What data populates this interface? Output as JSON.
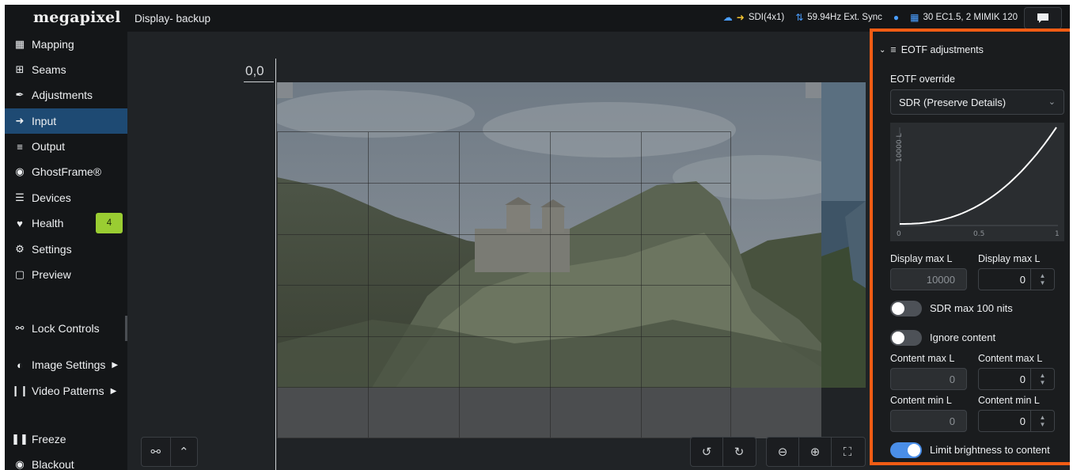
{
  "app": {
    "brand": "megapixel",
    "window_title": "Display- backup"
  },
  "status": {
    "input": "SDI(4x1)",
    "sync": "59.94Hz Ext. Sync",
    "devices": "30 EC1.5, 2 MIMIK 120"
  },
  "sidebar": {
    "items": [
      {
        "label": "Mapping",
        "icon": "grid-icon"
      },
      {
        "label": "Seams",
        "icon": "plus-square-icon"
      },
      {
        "label": "Adjustments",
        "icon": "brush-icon"
      },
      {
        "label": "Input",
        "icon": "input-arrow-icon"
      },
      {
        "label": "Output",
        "icon": "sliders-icon"
      },
      {
        "label": "GhostFrame®",
        "icon": "ghostframe-icon"
      },
      {
        "label": "Devices",
        "icon": "list-icon"
      },
      {
        "label": "Health",
        "icon": "heart-pulse-icon",
        "badge": "4"
      },
      {
        "label": "Settings",
        "icon": "gears-icon"
      },
      {
        "label": "Preview",
        "icon": "monitor-icon"
      },
      {
        "label": "Lock Controls",
        "icon": "unlock-icon"
      },
      {
        "label": "Image Settings",
        "icon": "contrast-icon"
      },
      {
        "label": "Video Patterns",
        "icon": "bars-icon"
      },
      {
        "label": "Freeze",
        "icon": "pause-icon"
      },
      {
        "label": "Blackout",
        "icon": "bulb-icon"
      }
    ],
    "active": "Input"
  },
  "canvas": {
    "origin_label": "0,0"
  },
  "panel": {
    "header": "EOTF adjustments",
    "eotf_override_label": "EOTF override",
    "eotf_override_value": "SDR (Preserve Details)",
    "chart_axis": {
      "y_label": "10000 L",
      "x_ticks": [
        "0",
        "0.5",
        "1"
      ]
    },
    "display_max_label_a": "Display max L",
    "display_max_value_a": "10000",
    "display_max_label_b": "Display max L",
    "display_max_value_b": "0",
    "sdr_toggle_label": "SDR max 100 nits",
    "sdr_toggle_on": false,
    "ignore_toggle_label": "Ignore content",
    "ignore_toggle_on": false,
    "content_max_label_a": "Content max L",
    "content_max_value_a": "0",
    "content_max_label_b": "Content max L",
    "content_max_value_b": "0",
    "content_min_label_a": "Content min L",
    "content_min_value_a": "0",
    "content_min_label_b": "Content min L",
    "content_min_value_b": "0",
    "limit_toggle_label": "Limit brightness to content",
    "limit_toggle_on": true
  }
}
